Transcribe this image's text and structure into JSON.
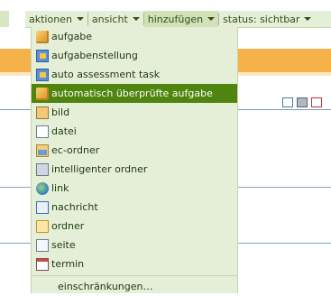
{
  "toolbar": {
    "items": [
      {
        "label": "aktionen"
      },
      {
        "label": "ansicht"
      },
      {
        "label": "hinzufügen"
      },
      {
        "label": "status: sichtbar"
      }
    ]
  },
  "menu": {
    "items": [
      {
        "label": "aufgabe",
        "icon": "cube-icon"
      },
      {
        "label": "aufgabenstellung",
        "icon": "exercise-icon"
      },
      {
        "label": "auto assessment task",
        "icon": "exercise-icon"
      },
      {
        "label": "automatisch überprüfte aufgabe",
        "icon": "cube-icon",
        "highlighted": true
      },
      {
        "label": "bild",
        "icon": "image-icon"
      },
      {
        "label": "datei",
        "icon": "file-icon"
      },
      {
        "label": "ec-ordner",
        "icon": "ec-folder-icon"
      },
      {
        "label": "intelligenter ordner",
        "icon": "smart-folder-icon"
      },
      {
        "label": "link",
        "icon": "link-icon"
      },
      {
        "label": "nachricht",
        "icon": "news-icon"
      },
      {
        "label": "ordner",
        "icon": "folder-icon"
      },
      {
        "label": "seite",
        "icon": "page-icon"
      },
      {
        "label": "termin",
        "icon": "calendar-icon"
      }
    ],
    "footer_label": "einschränkungen…"
  },
  "colors": {
    "toolbar_bg": "#e5eed7",
    "highlight": "#4f840e",
    "orange_band": "#f6b24a"
  }
}
